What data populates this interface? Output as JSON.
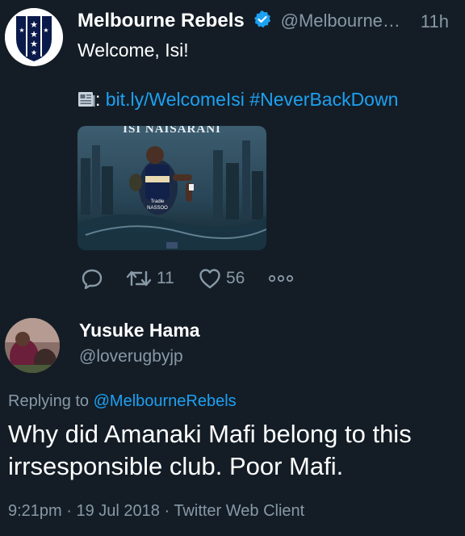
{
  "tweet": {
    "display_name": "Melbourne Rebels",
    "handle": "@Melbourne…",
    "time": "11h",
    "text": "Welcome, Isi!",
    "link_prefix": ":",
    "link": "bit.ly/WelcomeIsi",
    "hashtag": "#NeverBackDown",
    "media_caption": "ISI NAISARANI",
    "actions": {
      "retweets": "11",
      "likes": "56"
    }
  },
  "reply": {
    "display_name": "Yusuke Hama",
    "handle": "@loverugbyjp",
    "replying_to_label": "Replying to",
    "replying_to": "@MelbourneRebels",
    "text": "Why did Amanaki Mafi belong to this irrsesponsible club. Poor Mafi.",
    "meta": "9:21pm · 19 Jul 2018 · Twitter Web Client"
  },
  "colors": {
    "background": "#141d26",
    "accent": "#1da1f2",
    "muted": "#8899a6",
    "rebels_navy": "#0a1a4a"
  }
}
